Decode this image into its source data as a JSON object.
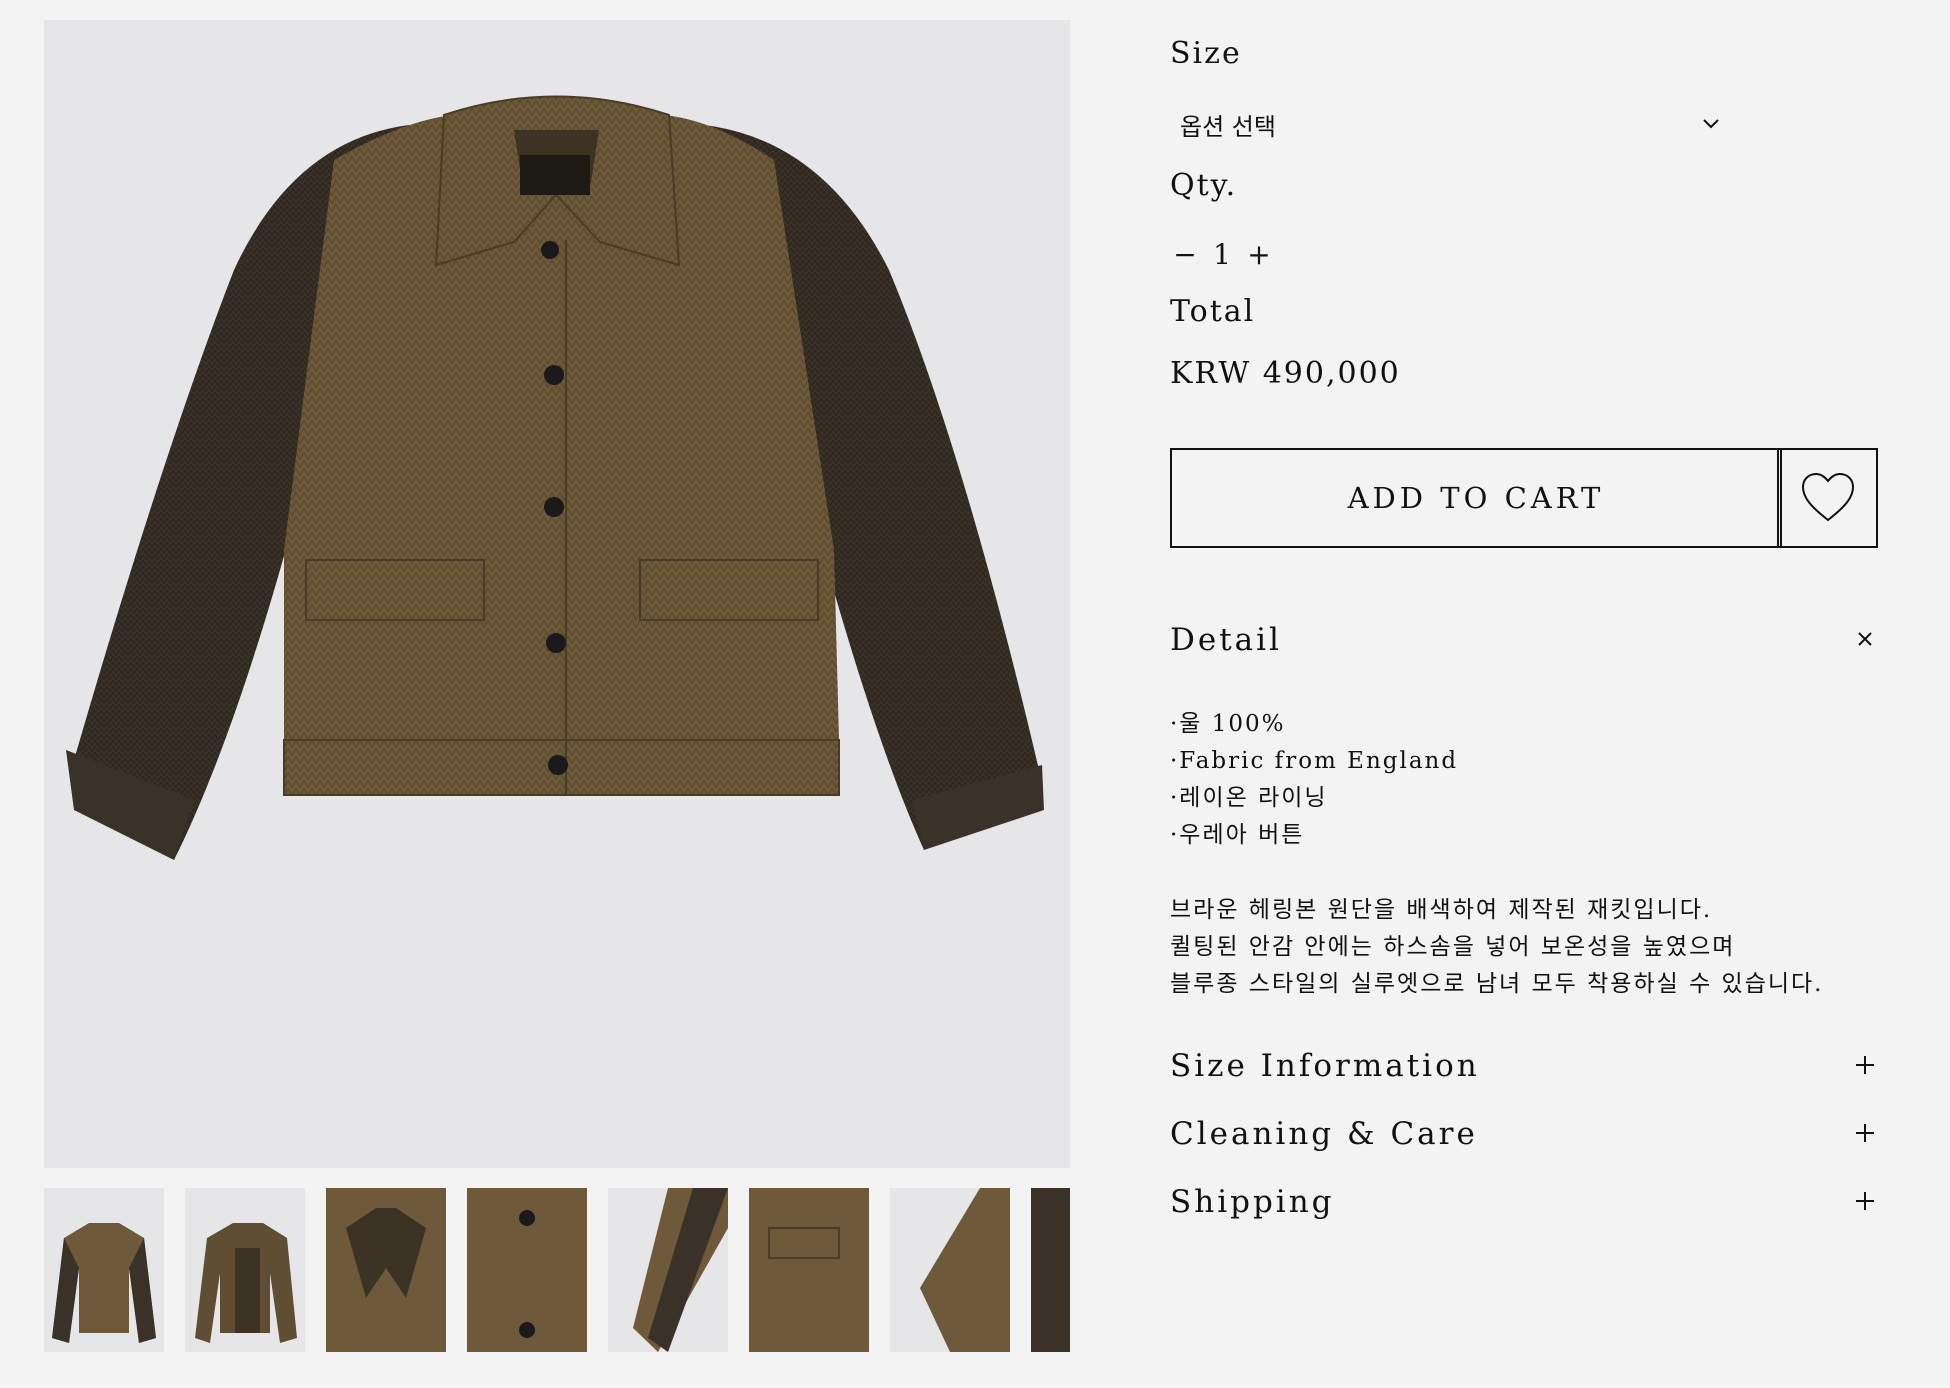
{
  "gallery": {
    "main_image_alt": "",
    "thumbnails": [
      "front",
      "back",
      "collar",
      "buttons",
      "sleeve",
      "pocket",
      "side",
      "detail"
    ]
  },
  "size": {
    "label": "Size",
    "selected": "옵션 선택"
  },
  "qty": {
    "label": "Qty.",
    "minus": "−",
    "value": "1",
    "plus": "+"
  },
  "total": {
    "label": "Total",
    "price": "KRW 490,000"
  },
  "cart": {
    "add_label": "ADD TO CART",
    "wishlist_icon": "heart-icon"
  },
  "detail": {
    "title": "Detail",
    "icon": "close-icon",
    "bullets": [
      "·울 100%",
      "·Fabric from England",
      "·레이온 라이닝",
      "·우레아 버튼"
    ],
    "description": [
      "브라운 헤링본 원단을 배색하여 제작된 재킷입니다.",
      "퀼팅된 안감 안에는 하스솜을 넣어 보온성을 높였으며",
      "블루종 스타일의 실루엣으로 남녀 모두 착용하실 수 있습니다."
    ]
  },
  "accordions": [
    {
      "title": "Size Information",
      "icon": "plus-icon"
    },
    {
      "title": "Cleaning & Care",
      "icon": "plus-icon"
    },
    {
      "title": "Shipping",
      "icon": "plus-icon"
    }
  ],
  "colors": {
    "background": "#f3f3f3",
    "image_bg": "#e6e6e8",
    "tweed": "#6e5a3a",
    "sleeve": "#3a3128",
    "text": "#111111"
  }
}
